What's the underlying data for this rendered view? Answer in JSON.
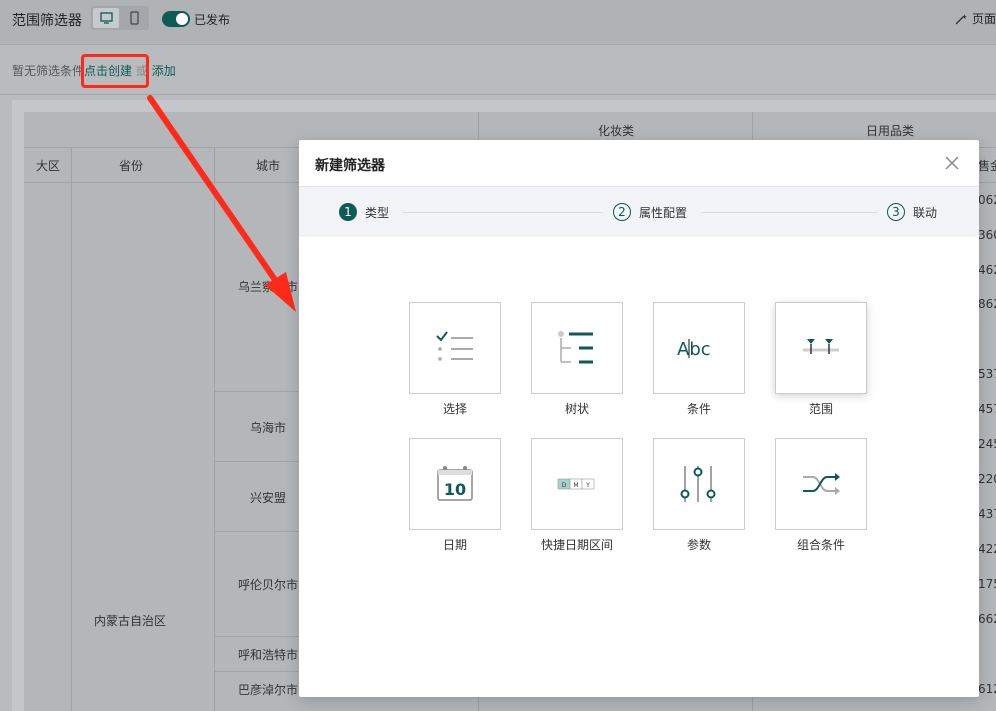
{
  "header": {
    "title": "范围筛选器",
    "publish_label": "已发布",
    "page_link": "页面"
  },
  "filterbar": {
    "empty_hint": "暂无筛选条件",
    "create_link": "点击创建",
    "or_text": "或",
    "add_link": "添加"
  },
  "background_table": {
    "group_headers": [
      "化妆类",
      "日用品类"
    ],
    "col_headers": [
      "大区",
      "省份",
      "城市",
      "售金"
    ],
    "region": "内蒙古自治区",
    "cities": [
      "乌兰察布市",
      "乌海市",
      "兴安盟",
      "呼伦贝尔市",
      "呼和浩特市",
      "巴彦淖尔市"
    ],
    "right_numbers": [
      "062",
      "360",
      "462",
      "862",
      "537",
      "457",
      "245",
      "220",
      "437",
      "422",
      "175",
      "662",
      "612"
    ]
  },
  "modal": {
    "title": "新建筛选器",
    "steps": [
      {
        "num": "1",
        "label": "类型"
      },
      {
        "num": "2",
        "label": "属性配置"
      },
      {
        "num": "3",
        "label": "联动"
      }
    ],
    "types": [
      {
        "label": "选择",
        "icon": "select-list-icon"
      },
      {
        "label": "树状",
        "icon": "tree-icon"
      },
      {
        "label": "条件",
        "icon": "text-condition-icon",
        "icon_text": "Abc"
      },
      {
        "label": "范围",
        "icon": "range-slider-icon"
      },
      {
        "label": "日期",
        "icon": "calendar-icon",
        "icon_text": "10"
      },
      {
        "label": "快捷日期区间",
        "icon": "quick-date-icon",
        "icon_text": [
          "D",
          "M",
          "Y"
        ]
      },
      {
        "label": "参数",
        "icon": "parameter-sliders-icon"
      },
      {
        "label": "组合条件",
        "icon": "combine-arrows-icon"
      }
    ]
  },
  "colors": {
    "accent": "#0e5a55",
    "annotation": "#ff2a1a"
  }
}
